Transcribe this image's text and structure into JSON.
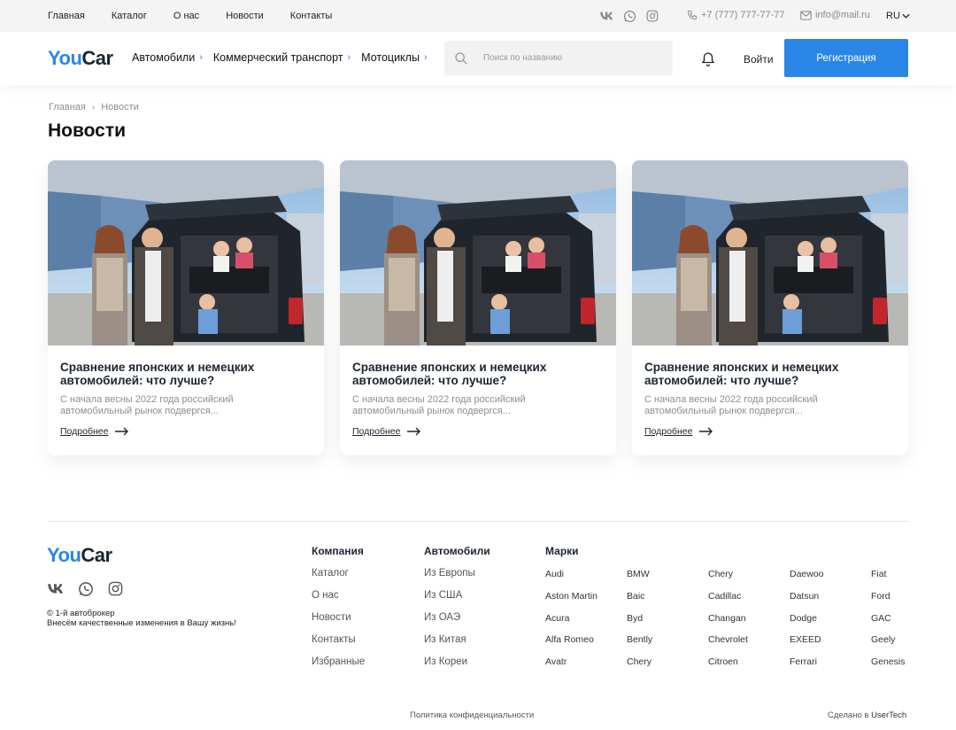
{
  "topbar": {
    "nav": [
      "Главная",
      "Каталог",
      "О нас",
      "Новости",
      "Контакты"
    ],
    "phone": "+7 (777) 777-77-77",
    "email": "info@mail.ru",
    "lang": "RU",
    "social_icons": [
      "vk-icon",
      "whatsapp-icon",
      "instagram-icon"
    ]
  },
  "header": {
    "logo_you": "You",
    "logo_car": "Car",
    "nav": [
      "Автомобили",
      "Коммерческий транспорт",
      "Мотоциклы"
    ],
    "search_placeholder": "Поиск по названию",
    "login": "Войти",
    "register": "Регистрация"
  },
  "breadcrumb": [
    "Главная",
    "Новости"
  ],
  "page_title": "Новости",
  "news": [
    {
      "title": "Сравнение японских и немецких автомобилей: что лучше?",
      "excerpt": "С начала весны 2022 года российский автомобильный рынок подвергся...",
      "more": "Подробнее"
    },
    {
      "title": "Сравнение японских и немецких автомобилей: что лучше?",
      "excerpt": "С начала весны 2022 года российский автомобильный рынок подвергся...",
      "more": "Подробнее"
    },
    {
      "title": "Сравнение японских и немецких автомобилей: что лучше?",
      "excerpt": "С начала весны 2022 года российский автомобильный рынок подвергся...",
      "more": "Подробнее"
    }
  ],
  "footer": {
    "logo_you": "You",
    "logo_car": "Car",
    "copyright_line1": "© 1-й автоброкер",
    "copyright_line2": "Внесём качественные изменения в Вашу жизнь!",
    "company": {
      "title": "Компания",
      "links": [
        "Каталог",
        "О нас",
        "Новости",
        "Контакты",
        "Избранные"
      ]
    },
    "cars": {
      "title": "Автомобили",
      "links": [
        "Из Европы",
        "Из США",
        "Из ОАЭ",
        "Из Китая",
        "Из Кореи"
      ]
    },
    "brands_title": "Марки",
    "brands": [
      "Audi",
      "BMW",
      "Chery",
      "Daewoo",
      "Fiat",
      "Aston Martin",
      "Baic",
      "Cadillac",
      "Datsun",
      "Ford",
      "Acura",
      "Byd",
      "Changan",
      "Dodge",
      "GAC",
      "Alfa Romeo",
      "Bently",
      "Chevrolet",
      "EXEED",
      "Geely",
      "Avatr",
      "Chery",
      "Citroen",
      "Ferrari",
      "Genesis"
    ],
    "policy": "Политика конфиденциальности",
    "made_by_prefix": "Сделано в",
    "made_by_name": "UserTech"
  },
  "colors": {
    "accent": "#2a86e6",
    "dark": "#1d2430",
    "topbar_bg": "#f4f4f4"
  }
}
